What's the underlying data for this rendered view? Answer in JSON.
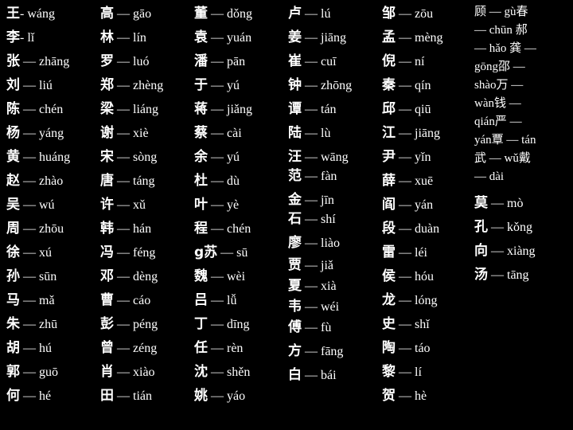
{
  "columns": [
    {
      "entries": [
        {
          "char": "王",
          "sep": "- ",
          "pinyin": "wáng"
        },
        {
          "char": "李",
          "sep": "- ",
          "pinyin": "lǐ"
        },
        {
          "char": "张",
          "sep": " — ",
          "pinyin": "zhāng"
        },
        {
          "char": "刘",
          "sep": " — ",
          "pinyin": "liú"
        },
        {
          "char": "陈",
          "sep": " — ",
          "pinyin": "chén"
        },
        {
          "char": "杨",
          "sep": " — ",
          "pinyin": "yáng"
        },
        {
          "char": "黄",
          "sep": " — ",
          "pinyin": "huáng"
        },
        {
          "char": "赵",
          "sep": " — ",
          "pinyin": "zhào"
        },
        {
          "char": "吴",
          "sep": " — ",
          "pinyin": "wú"
        },
        {
          "char": "周",
          "sep": " — ",
          "pinyin": "zhōu"
        },
        {
          "char": "徐",
          "sep": " — ",
          "pinyin": "xú"
        },
        {
          "char": "孙",
          "sep": " — ",
          "pinyin": "sūn"
        },
        {
          "char": "马",
          "sep": " — ",
          "pinyin": "mǎ"
        },
        {
          "char": "朱",
          "sep": " — ",
          "pinyin": "zhū"
        },
        {
          "char": "胡",
          "sep": " — ",
          "pinyin": "hú"
        },
        {
          "char": "郭",
          "sep": " — ",
          "pinyin": "guō"
        },
        {
          "char": "何",
          "sep": " — ",
          "pinyin": "hé"
        }
      ]
    },
    {
      "entries": [
        {
          "char": "高",
          "sep": " — ",
          "pinyin": "gāo"
        },
        {
          "char": "林",
          "sep": " — ",
          "pinyin": "lín"
        },
        {
          "char": "罗",
          "sep": " — ",
          "pinyin": "luó"
        },
        {
          "char": "郑",
          "sep": " — ",
          "pinyin": "zhèng"
        },
        {
          "char": "梁",
          "sep": " — ",
          "pinyin": "liáng"
        },
        {
          "char": "谢",
          "sep": " — ",
          "pinyin": "xiè"
        },
        {
          "char": "宋",
          "sep": " — ",
          "pinyin": "sòng"
        },
        {
          "char": "唐",
          "sep": " — ",
          "pinyin": "táng"
        },
        {
          "char": "许",
          "sep": " — ",
          "pinyin": "xǔ"
        },
        {
          "char": "韩",
          "sep": " — ",
          "pinyin": "hán"
        },
        {
          "char": "冯",
          "sep": " — ",
          "pinyin": "féng"
        },
        {
          "char": "邓",
          "sep": " — ",
          "pinyin": "dèng"
        },
        {
          "char": "曹",
          "sep": " — ",
          "pinyin": "cáo"
        },
        {
          "char": "彭",
          "sep": " — ",
          "pinyin": "péng"
        },
        {
          "char": "曾",
          "sep": " — ",
          "pinyin": "zéng"
        },
        {
          "char": "肖",
          "sep": " — ",
          "pinyin": "xiào"
        },
        {
          "char": "田",
          "sep": " — ",
          "pinyin": "tián"
        }
      ]
    },
    {
      "entries": [
        {
          "char": "董",
          "sep": " — ",
          "pinyin": "dǒng"
        },
        {
          "char": "袁",
          "sep": " — ",
          "pinyin": "yuán"
        },
        {
          "char": "潘",
          "sep": " — ",
          "pinyin": "pān"
        },
        {
          "char": "于",
          "sep": " — ",
          "pinyin": "yú"
        },
        {
          "char": "蒋",
          "sep": " — ",
          "pinyin": "jiǎng"
        },
        {
          "char": "蔡",
          "sep": " — ",
          "pinyin": "cài"
        },
        {
          "char": "余",
          "sep": " — ",
          "pinyin": "yú"
        },
        {
          "char": "杜",
          "sep": " — ",
          "pinyin": "dù"
        },
        {
          "char": "叶",
          "sep": " — ",
          "pinyin": "yè"
        },
        {
          "char": "程",
          "sep": " — ",
          "pinyin": "chén"
        },
        {
          "char": "g苏",
          "sep": " — ",
          "pinyin": "sū"
        },
        {
          "char": "魏",
          "sep": " — ",
          "pinyin": "wèi"
        },
        {
          "char": "吕",
          "sep": " — ",
          "pinyin": "lǚ"
        },
        {
          "char": "丁",
          "sep": " — ",
          "pinyin": "dīng"
        },
        {
          "char": "任",
          "sep": " — ",
          "pinyin": "rèn"
        },
        {
          "char": "沈",
          "sep": " — ",
          "pinyin": "shěn"
        },
        {
          "char": "姚",
          "sep": " — ",
          "pinyin": "yáo"
        }
      ]
    },
    {
      "entries": [
        {
          "char": "卢",
          "sep": " — ",
          "pinyin": "lú"
        },
        {
          "char": "姜",
          "sep": " — ",
          "pinyin": "jiāng"
        },
        {
          "char": "崔",
          "sep": " — ",
          "pinyin": "cuī"
        },
        {
          "char": "钟",
          "sep": " — ",
          "pinyin": "zhōng"
        },
        {
          "char": "谭",
          "sep": " — ",
          "pinyin": "tán"
        },
        {
          "char": "陆",
          "sep": " — ",
          "pinyin": "lù"
        },
        {
          "char": "汪",
          "sep": " — ",
          "pinyin": "wāng"
        },
        {
          "char": "范",
          "sep": " — ",
          "pinyin": "fàn"
        },
        {
          "char": "金",
          "sep": " — ",
          "pinyin": "jīn"
        },
        {
          "char": "石",
          "sep": " — ",
          "pinyin": "shí"
        },
        {
          "char": "廖",
          "sep": " — ",
          "pinyin": "liào"
        },
        {
          "char": "贾",
          "sep": " — ",
          "pinyin": "jiǎ"
        },
        {
          "char": "夏",
          "sep": " — ",
          "pinyin": "xià"
        },
        {
          "char": "韦",
          "sep": " — ",
          "pinyin": "wéi"
        },
        {
          "char": "傅",
          "sep": " — ",
          "pinyin": "fù"
        },
        {
          "char": "方",
          "sep": " — ",
          "pinyin": "fāng"
        },
        {
          "char": "白",
          "sep": " — ",
          "pinyin": "bái"
        }
      ]
    },
    {
      "entries": [
        {
          "char": "邹",
          "sep": " — ",
          "pinyin": "zōu"
        },
        {
          "char": "孟",
          "sep": " — ",
          "pinyin": "mèng"
        },
        {
          "char": "倪",
          "sep": " — ",
          "pinyin": "ní"
        },
        {
          "char": "秦",
          "sep": " — ",
          "pinyin": "qín"
        },
        {
          "char": "邱",
          "sep": " — ",
          "pinyin": "qiū"
        },
        {
          "char": "江",
          "sep": " — ",
          "pinyin": "jiāng"
        },
        {
          "char": "尹",
          "sep": " — ",
          "pinyin": "yǐn"
        },
        {
          "char": "薛",
          "sep": " — ",
          "pinyin": "xuē"
        },
        {
          "char": "阎",
          "sep": " — ",
          "pinyin": "yán"
        },
        {
          "char": "段",
          "sep": " — ",
          "pinyin": "duàn"
        },
        {
          "char": "雷",
          "sep": " — ",
          "pinyin": "léi"
        },
        {
          "char": "侯",
          "sep": " — ",
          "pinyin": "hóu"
        },
        {
          "char": "龙",
          "sep": " — ",
          "pinyin": "lóng"
        },
        {
          "char": "史",
          "sep": " — ",
          "pinyin": "shǐ"
        },
        {
          "char": "陶",
          "sep": " — ",
          "pinyin": "táo"
        },
        {
          "char": "黎",
          "sep": " — ",
          "pinyin": "lí"
        },
        {
          "char": "贺",
          "sep": " — ",
          "pinyin": "hè"
        }
      ]
    }
  ],
  "last_column": {
    "lines": [
      "顾 — gù春",
      "— chūn 郝",
      "— hǎo 龚 —",
      "gōng邵 —",
      "shào万 —",
      "wàn钱 —",
      "qián严 —",
      "yán覃 — tán",
      "武 — wǔ戴",
      "— dài"
    ],
    "entries": [
      {
        "char": "莫",
        "sep": " — ",
        "pinyin": "mò"
      },
      {
        "char": "孔",
        "sep": " — ",
        "pinyin": "kǒng"
      },
      {
        "char": "向",
        "sep": " — ",
        "pinyin": "xiàng"
      },
      {
        "char": "汤",
        "sep": " — ",
        "pinyin": "tāng"
      }
    ]
  }
}
